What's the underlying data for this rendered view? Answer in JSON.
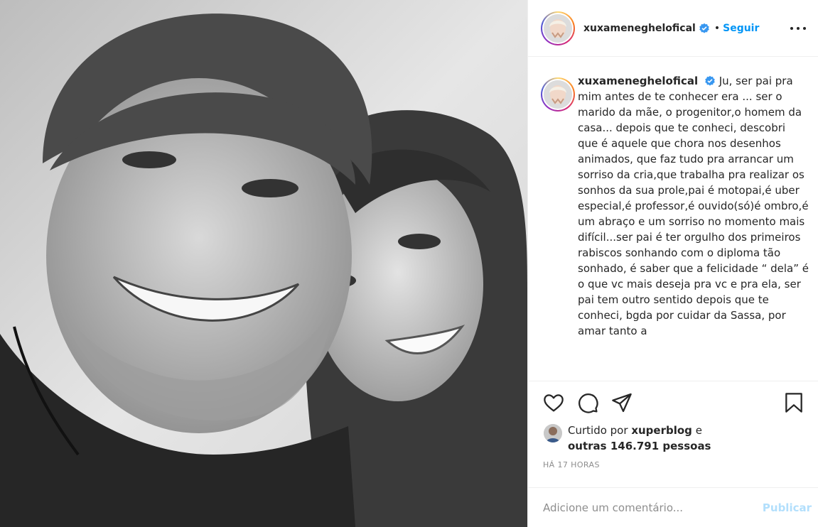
{
  "post": {
    "photo_alt": "",
    "author": {
      "username": "xuxameneghelofical",
      "verified_icon": "verified-badge-icon",
      "separator": "•",
      "follow_label": "Seguir"
    },
    "more_icon": "more-options-icon",
    "caption": {
      "username": "xuxameneghelofical",
      "text": "Ju, ser pai pra mim antes de te conhecer era ... ser o marido da mãe, o progenitor,o homem da casa... depois que te conheci, descobri que é aquele que chora nos desenhos animados, que faz tudo pra arrancar um sorriso da cria,que trabalha pra realizar os sonhos da sua prole,pai é motopai,é uber especial,é professor,é ouvido(só)é ombro,é um abraço e um sorriso no momento mais difícil...ser pai é ter orgulho dos primeiros rabiscos sonhando com o diploma tão sonhado, é saber que a felicidade “ dela” é o que vc mais deseja pra vc e pra ela, ser pai tem outro sentido depois que te conheci, bgda por cuidar da Sassa, por amar tanto a"
    },
    "actions": {
      "like_icon": "heart-icon",
      "comment_icon": "comment-icon",
      "share_icon": "share-icon",
      "save_icon": "bookmark-icon"
    },
    "likes": {
      "prefix": "Curtido por",
      "liked_by_user": "xuperblog",
      "conjunction": "e",
      "others": "outras 146.791 pessoas"
    },
    "timestamp": "HÁ 17 HORAS",
    "comment": {
      "placeholder": "Adicione um comentário...",
      "publish_label": "Publicar"
    },
    "colors": {
      "accent": "#0095f6",
      "publish_disabled": "#b2dffc",
      "text": "#262626",
      "muted": "#8e8e8e",
      "border": "#efefef"
    }
  }
}
